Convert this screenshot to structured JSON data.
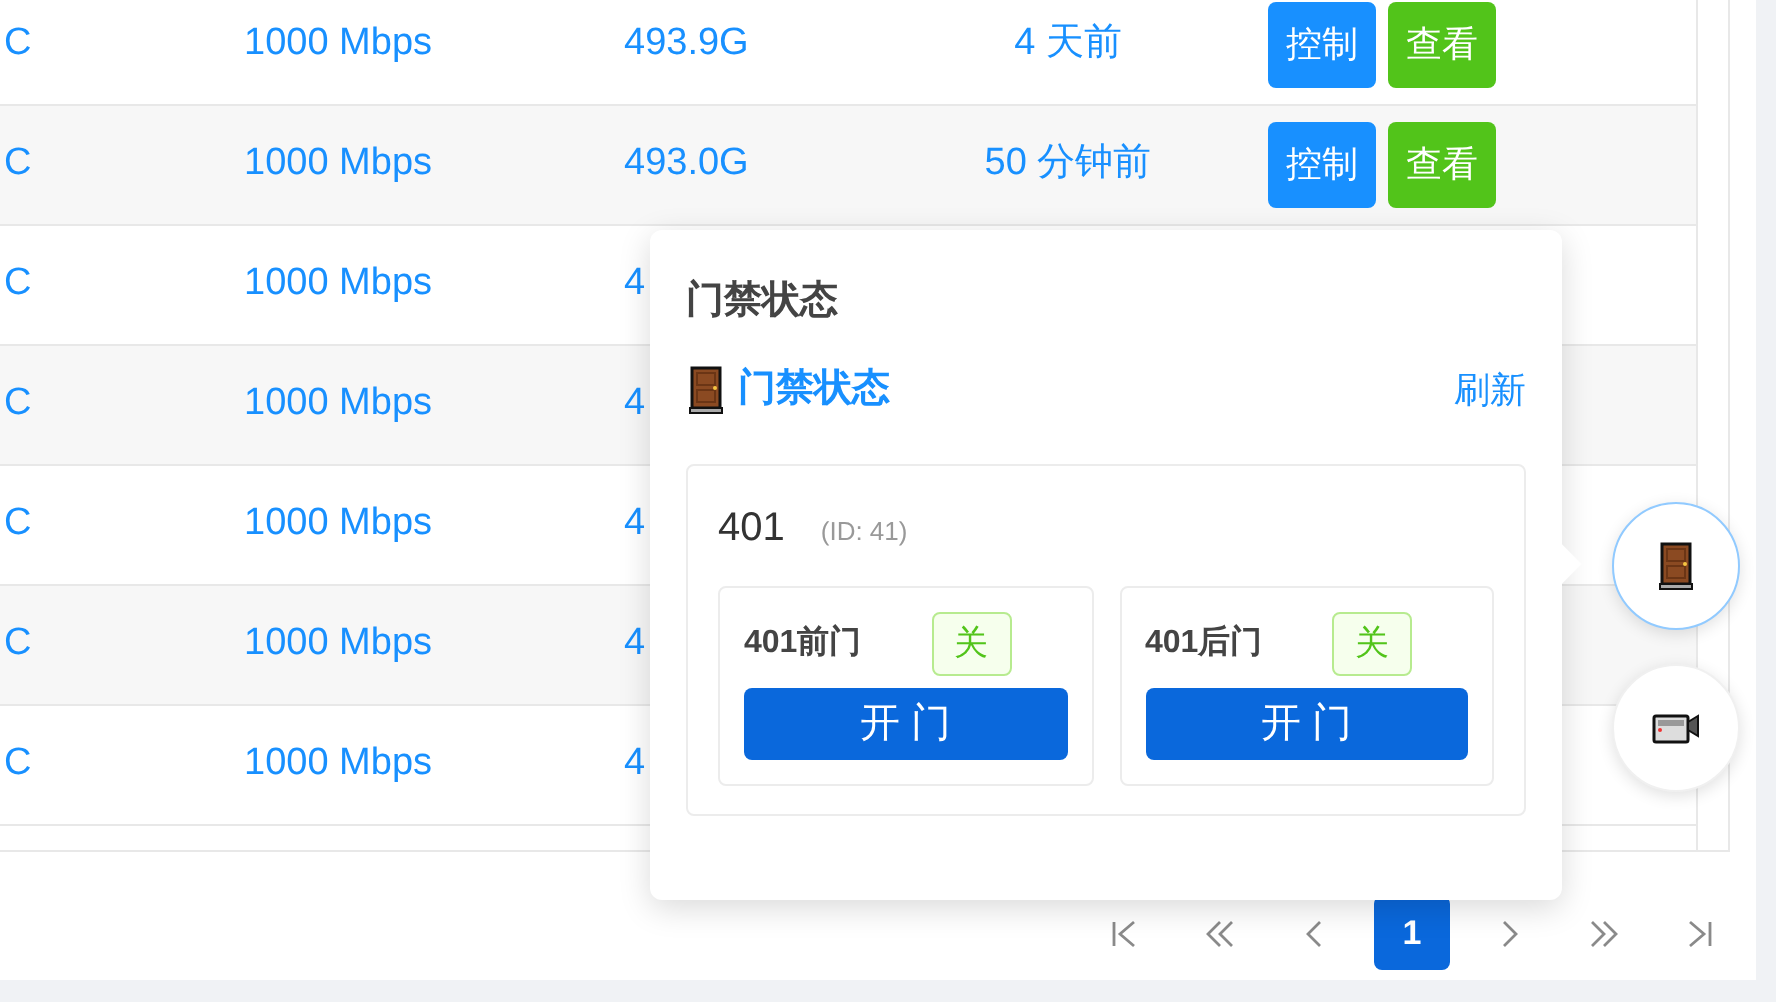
{
  "table": {
    "rows": [
      {
        "column_1": "C",
        "column_2": "1000 Mbps",
        "column_3": "493.9G",
        "column_4": "4 天前",
        "actions": [
          {
            "label": "控制",
            "kind": "primary"
          },
          {
            "label": "查看",
            "kind": "success"
          }
        ]
      },
      {
        "column_1": "C",
        "column_2": "1000 Mbps",
        "column_3": "493.0G",
        "column_4": "50 分钟前",
        "actions": [
          {
            "label": "控制",
            "kind": "primary"
          },
          {
            "label": "查看",
            "kind": "success"
          }
        ]
      },
      {
        "column_1": "C",
        "column_2": "1000 Mbps",
        "column_3": "4"
      },
      {
        "column_1": "C",
        "column_2": "1000 Mbps",
        "column_3": "4"
      },
      {
        "column_1": "C",
        "column_2": "1000 Mbps",
        "column_3": "4"
      },
      {
        "column_1": "C",
        "column_2": "1000 Mbps",
        "column_3": "4"
      },
      {
        "column_1": "C",
        "column_2": "1000 Mbps",
        "column_3": "4"
      }
    ]
  },
  "pagination": [
    {
      "kind": "first"
    },
    {
      "kind": "prev_fast"
    },
    {
      "kind": "prev"
    },
    {
      "kind": "page",
      "label": "1",
      "selected": true
    },
    {
      "kind": "next"
    },
    {
      "kind": "next_fast"
    },
    {
      "kind": "last"
    }
  ],
  "popover": {
    "title": "门禁状态",
    "header": {
      "title": "门禁状态",
      "refresh": "刷新"
    },
    "room": {
      "name": "401",
      "id": "(ID: 41)",
      "doors": [
        {
          "name": "401前门",
          "status": "关",
          "button": "开 门"
        },
        {
          "name": "401后门",
          "status": "关",
          "button": "开 门"
        }
      ]
    }
  },
  "floating_buttons": [
    {
      "kind": "door",
      "selected": true
    },
    {
      "kind": "camera",
      "selected": false
    }
  ]
}
